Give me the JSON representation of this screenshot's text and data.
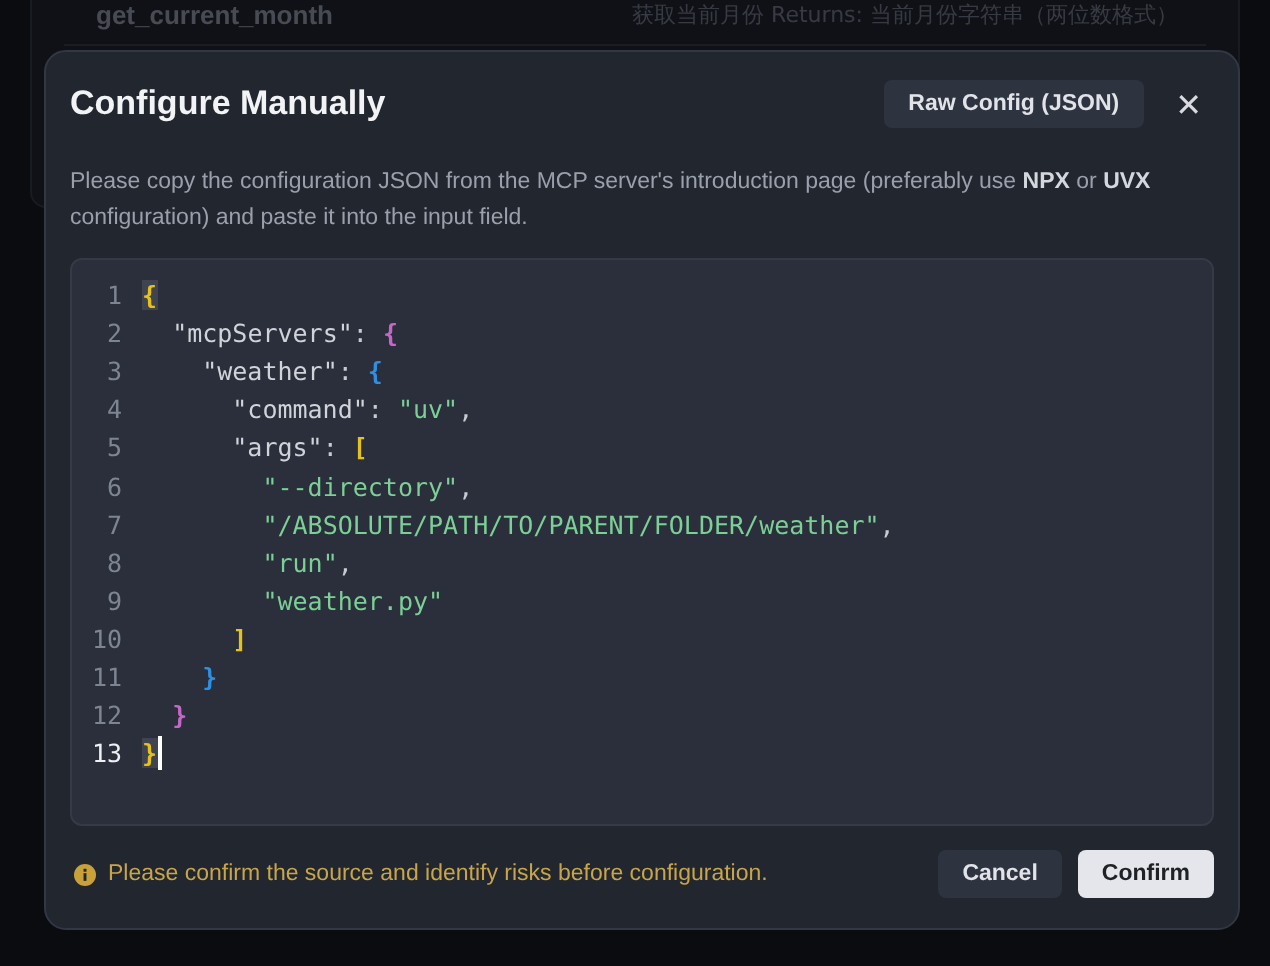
{
  "background": {
    "tool_name": "get_current_month",
    "tool_description": "获取当前月份 Returns: 当前月份字符串（两位数格式）"
  },
  "dialog": {
    "title": "Configure Manually",
    "raw_config_button": "Raw Config (JSON)",
    "close": "✕",
    "description": "Please copy the configuration JSON from the MCP server's introduction page (preferably use **NPX** or **UVX** configuration) and paste it into the input field.",
    "editor": {
      "lines": [
        {
          "number": "1",
          "active": false,
          "tokens": [
            {
              "kind": "bracket",
              "text": "{",
              "color": "#e5c21a",
              "matched": true
            }
          ]
        },
        {
          "number": "2",
          "active": false,
          "tokens": [
            {
              "kind": "key",
              "text": "  \"mcpServers\""
            },
            {
              "kind": "punct",
              "text": ": "
            },
            {
              "kind": "bracket",
              "text": "{",
              "color": "#c667c8",
              "matched": false
            }
          ]
        },
        {
          "number": "3",
          "active": false,
          "tokens": [
            {
              "kind": "key",
              "text": "    \"weather\""
            },
            {
              "kind": "punct",
              "text": ": "
            },
            {
              "kind": "bracket",
              "text": "{",
              "color": "#2f8fe0",
              "matched": false
            }
          ]
        },
        {
          "number": "4",
          "active": false,
          "tokens": [
            {
              "kind": "key",
              "text": "      \"command\""
            },
            {
              "kind": "punct",
              "text": ": "
            },
            {
              "kind": "string",
              "text": "\"uv\""
            },
            {
              "kind": "punct",
              "text": ","
            }
          ]
        },
        {
          "number": "5",
          "active": false,
          "tokens": [
            {
              "kind": "key",
              "text": "      \"args\""
            },
            {
              "kind": "punct",
              "text": ": "
            },
            {
              "kind": "bracket",
              "text": "[",
              "color": "#e5c21a",
              "matched": false
            }
          ]
        },
        {
          "number": "6",
          "active": false,
          "tokens": [
            {
              "kind": "string",
              "text": "        \"--directory\""
            },
            {
              "kind": "punct",
              "text": ","
            }
          ]
        },
        {
          "number": "7",
          "active": false,
          "tokens": [
            {
              "kind": "string",
              "text": "        \"/ABSOLUTE/PATH/TO/PARENT/FOLDER/weather\""
            },
            {
              "kind": "punct",
              "text": ","
            }
          ]
        },
        {
          "number": "8",
          "active": false,
          "tokens": [
            {
              "kind": "string",
              "text": "        \"run\""
            },
            {
              "kind": "punct",
              "text": ","
            }
          ]
        },
        {
          "number": "9",
          "active": false,
          "tokens": [
            {
              "kind": "string",
              "text": "        \"weather.py\""
            }
          ]
        },
        {
          "number": "10",
          "active": false,
          "tokens": [
            {
              "kind": "bracket",
              "text": "      ]",
              "color": "#e5c21a",
              "matched": false
            }
          ]
        },
        {
          "number": "11",
          "active": false,
          "tokens": [
            {
              "kind": "bracket",
              "text": "    }",
              "color": "#2f8fe0",
              "matched": false
            }
          ]
        },
        {
          "number": "12",
          "active": false,
          "tokens": [
            {
              "kind": "bracket",
              "text": "  }",
              "color": "#c667c8",
              "matched": false
            }
          ]
        },
        {
          "number": "13",
          "active": true,
          "tokens": [
            {
              "kind": "bracket",
              "text": "}",
              "color": "#e5c21a",
              "matched": true
            }
          ]
        }
      ]
    },
    "warning": "Please confirm the source and identify risks before configuration.",
    "buttons": [
      {
        "kind": "secondary",
        "label": "Cancel"
      },
      {
        "kind": "primary",
        "label": "Confirm"
      }
    ]
  }
}
